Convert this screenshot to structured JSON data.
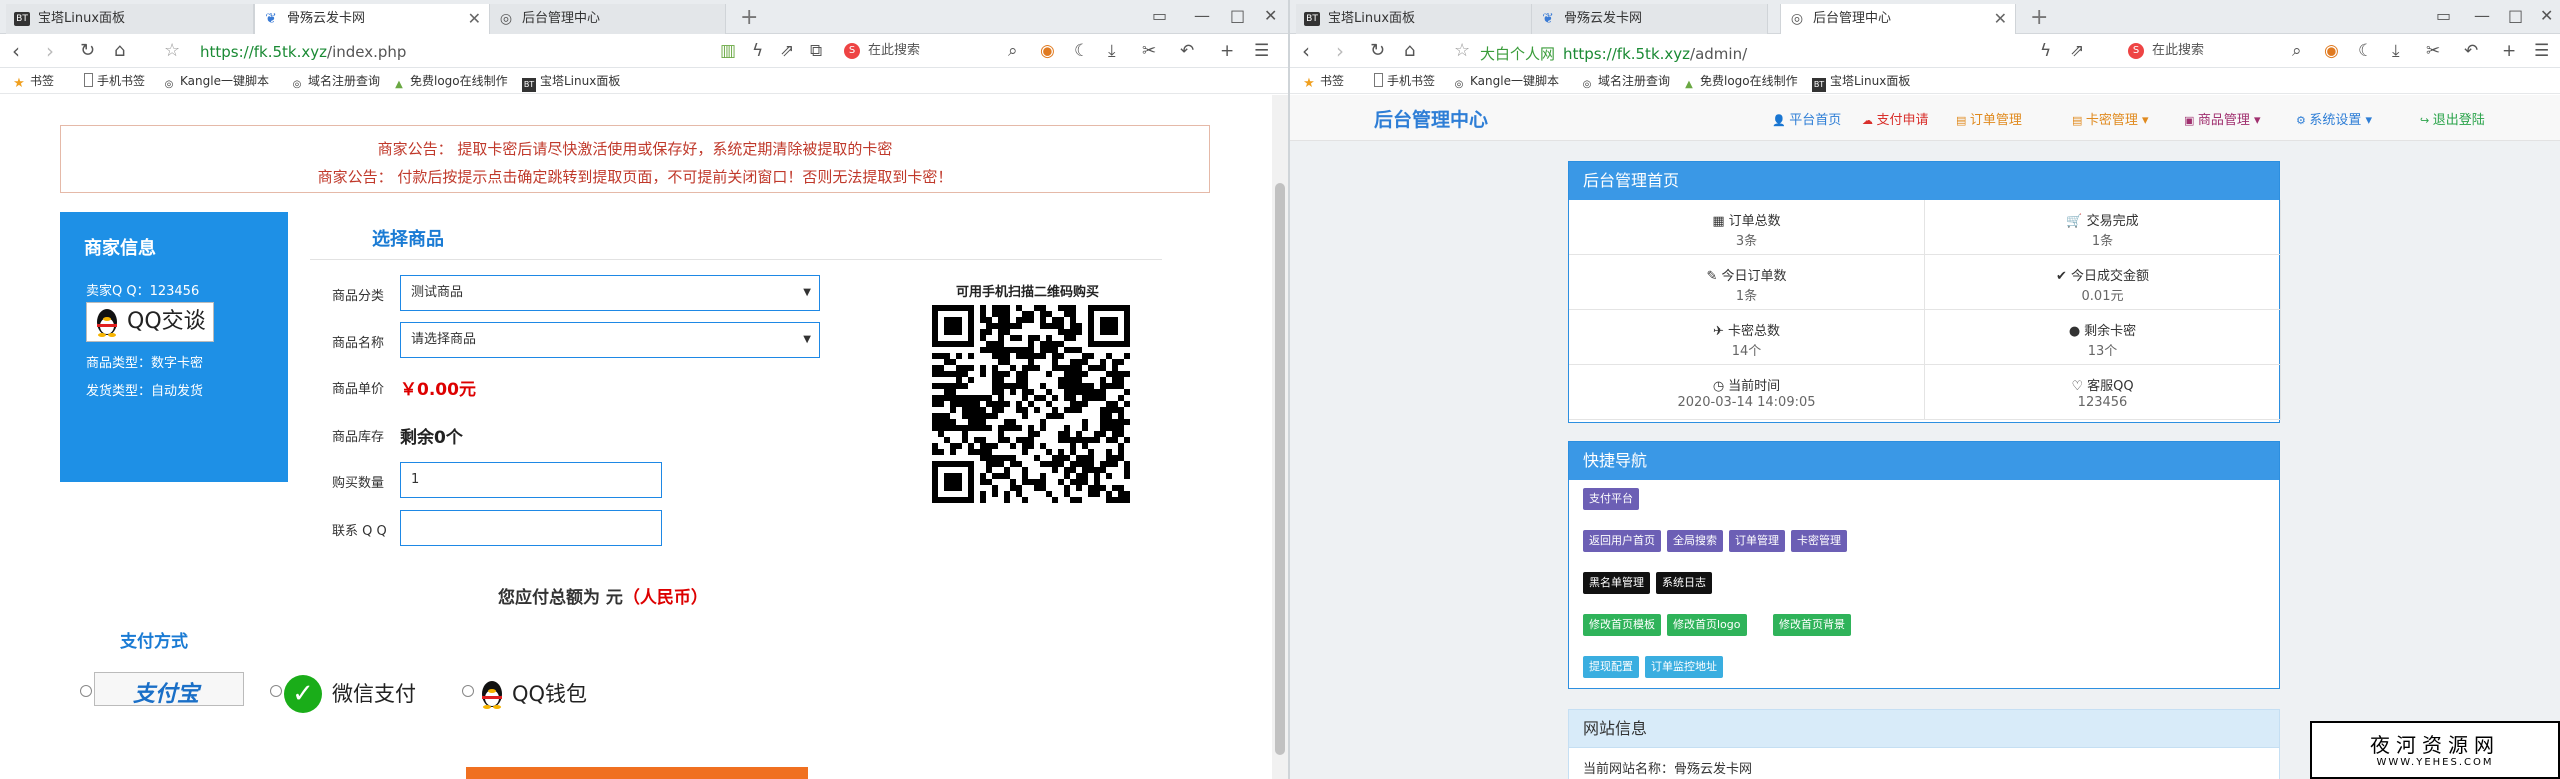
{
  "left": {
    "tabs": [
      {
        "label": "宝塔Linux面板",
        "icon": "bt-icon"
      },
      {
        "label": "骨殇云发卡网",
        "icon": "leaf-icon"
      },
      {
        "label": "后台管理中心",
        "icon": "globe-icon"
      }
    ],
    "url": {
      "host": "https://fk.5tk.xyz",
      "path": "/index.php"
    },
    "search_placeholder": "在此搜索",
    "bookmarks": [
      "书签",
      "手机书签",
      "Kangle一键脚本",
      "域名注册查询",
      "免费logo在线制作",
      "宝塔Linux面板"
    ],
    "notices": [
      "商家公告： 提取卡密后请尽快激活使用或保存好，系统定期清除被提取的卡密",
      "商家公告： 付款后按提示点击确定跳转到提取页面，不可提前关闭窗口！否则无法提取到卡密！"
    ],
    "merchant": {
      "title": "商家信息",
      "qq": "卖家Q Q：123456",
      "qq_button": "QQ交谈",
      "type": "商品类型：数字卡密",
      "delivery": "发货类型：自动发货"
    },
    "form": {
      "section_title": "选择商品",
      "category_label": "商品分类",
      "category_value": "测试商品",
      "name_label": "商品名称",
      "name_value": "请选择商品",
      "price_label": "商品单价",
      "price_value": "￥0.00元",
      "stock_label": "商品库存",
      "stock_value": "剩余0个",
      "qty_label": "购买数量",
      "qty_value": "1",
      "contact_label": "联系 Q Q",
      "contact_value": ""
    },
    "qr_label": "可用手机扫描二维码购买",
    "total_text": "您应付总额为 元",
    "total_unit": "（人民币）",
    "payment": {
      "title": "支付方式",
      "alipay": "支付宝",
      "wechat": "微信支付",
      "qq": "QQ钱包"
    }
  },
  "right": {
    "tabs": [
      {
        "label": "宝塔Linux面板",
        "icon": "bt-icon"
      },
      {
        "label": "骨殇云发卡网",
        "icon": "leaf-icon"
      },
      {
        "label": "后台管理中心",
        "icon": "globe-icon"
      }
    ],
    "url": {
      "prefix": "大白个人网",
      "host": "https://fk.5tk.xyz",
      "path": "/admin/"
    },
    "search_placeholder": "在此搜索",
    "bookmarks": [
      "书签",
      "手机书签",
      "Kangle一键脚本",
      "域名注册查询",
      "免费logo在线制作",
      "宝塔Linux面板"
    ],
    "brand": "后台管理中心",
    "nav": [
      {
        "label": "平台首页",
        "color": "#2e7ed6",
        "icon": "user-icon"
      },
      {
        "label": "支付申请",
        "color": "#d9302c",
        "icon": "cloud-icon"
      },
      {
        "label": "订单管理",
        "color": "#e08a1e",
        "icon": "list-icon"
      },
      {
        "label": "卡密管理 ▾",
        "color": "#e08a1e",
        "icon": "card-icon"
      },
      {
        "label": "商品管理 ▾",
        "color": "#a0306f",
        "icon": "box-icon"
      },
      {
        "label": "系统设置 ▾",
        "color": "#2e7ed6",
        "icon": "gear-icon"
      },
      {
        "label": "退出登陆",
        "color": "#2aa34a",
        "icon": "logout-icon"
      }
    ],
    "home_panel": {
      "title": "后台管理首页",
      "cells": [
        {
          "icon": "▦",
          "label": "订单总数",
          "value": "3条"
        },
        {
          "icon": "🛒",
          "label": "交易完成",
          "value": "1条"
        },
        {
          "icon": "✎",
          "label": "今日订单数",
          "value": "1条"
        },
        {
          "icon": "✔",
          "label": "今日成交金额",
          "value": "0.01元"
        },
        {
          "icon": "✈",
          "label": "卡密总数",
          "value": "14个"
        },
        {
          "icon": "●",
          "label": "剩余卡密",
          "value": "13个"
        },
        {
          "icon": "◷",
          "label": "当前时间",
          "value": "2020-03-14 14:09:05"
        },
        {
          "icon": "♡",
          "label": "客服QQ",
          "value": "123456"
        }
      ]
    },
    "quick_panel": {
      "title": "快捷导航",
      "rows": [
        [
          {
            "label": "支付平台",
            "color": "#6c5fb5"
          }
        ],
        [
          {
            "label": "返回用户首页",
            "color": "#6c5fb5"
          },
          {
            "label": "全局搜索",
            "color": "#6c5fb5"
          },
          {
            "label": "订单管理",
            "color": "#6c5fb5"
          },
          {
            "label": "卡密管理",
            "color": "#6c5fb5"
          }
        ],
        [
          {
            "label": "黑名单管理",
            "color": "#111111"
          },
          {
            "label": "系统日志",
            "color": "#111111"
          }
        ],
        [
          {
            "label": "修改首页模板",
            "color": "#2fb35a"
          },
          {
            "label": "修改首页logo",
            "color": "#2fb35a"
          },
          {
            "label": "修改首页背景",
            "color": "#2fb35a"
          }
        ],
        [
          {
            "label": "提现配置",
            "color": "#3aaee0"
          },
          {
            "label": "订单监控地址",
            "color": "#3aaee0"
          }
        ]
      ]
    },
    "site_panel": {
      "title": "网站信息",
      "site_name": "当前网站名称：骨殇云发卡网"
    }
  },
  "watermark": {
    "title": "夜河资源网",
    "url": "WWW.YEHES.COM"
  }
}
